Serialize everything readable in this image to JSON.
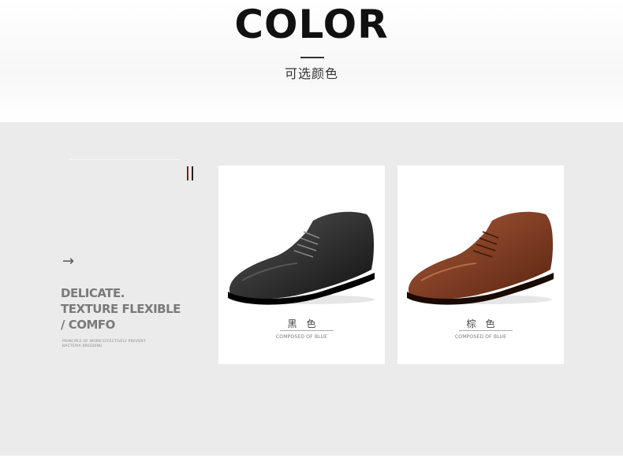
{
  "header": {
    "title": "COLOR",
    "subtitle": "可选颜色"
  },
  "intro": {
    "arrow_icon": "arrow-right-icon",
    "headline_lines": [
      "DELICATE.",
      "TEXTURE FLEXIBLE",
      "/ COMFO"
    ],
    "small_lines": [
      "PRINCIPLE OF WORK EFFECTIVELY PREVENT",
      "BACTERIA BREEDING"
    ],
    "stripe_colors": [
      "#8b1a1a",
      "#222222"
    ]
  },
  "products": [
    {
      "color_name": "黑色",
      "caption": "COMPOSED OF BLUE",
      "shoe_color": "#111111",
      "shoe_highlight": "#555555"
    },
    {
      "color_name": "棕色",
      "caption": "COMPOSED OF BLUE",
      "shoe_color": "#5a2412",
      "shoe_highlight": "#a85a38"
    }
  ]
}
